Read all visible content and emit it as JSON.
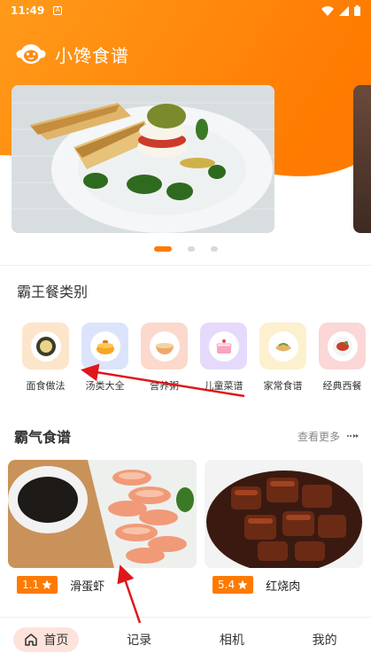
{
  "status_bar": {
    "time": "11:49",
    "notification": "A"
  },
  "app": {
    "title": "小馋食谱"
  },
  "banner": {
    "pages": 3,
    "active_index": 0
  },
  "categories_section": {
    "title": "霸王餐类别"
  },
  "categories": [
    {
      "label": "面食做法",
      "color": "#fde5cc"
    },
    {
      "label": "汤类大全",
      "color": "#dbe4fb"
    },
    {
      "label": "营养粥",
      "color": "#fbd9cc"
    },
    {
      "label": "儿童菜谱",
      "color": "#e5dafb"
    },
    {
      "label": "家常食谱",
      "color": "#fdf0cf"
    },
    {
      "label": "经典西餐",
      "color": "#fbd7d7"
    }
  ],
  "recipes_section": {
    "title": "霸气食谱",
    "more": "查看更多"
  },
  "recipes": [
    {
      "rating": "1.1",
      "name": "滑蛋虾"
    },
    {
      "rating": "5.4",
      "name": "红烧肉"
    }
  ],
  "tabbar": {
    "items": [
      {
        "label": "首页",
        "active": true
      },
      {
        "label": "记录",
        "active": false
      },
      {
        "label": "相机",
        "active": false
      },
      {
        "label": "我的",
        "active": false
      }
    ]
  },
  "colors": {
    "accent": "#ff7a00",
    "annotation": "#e0161b"
  }
}
